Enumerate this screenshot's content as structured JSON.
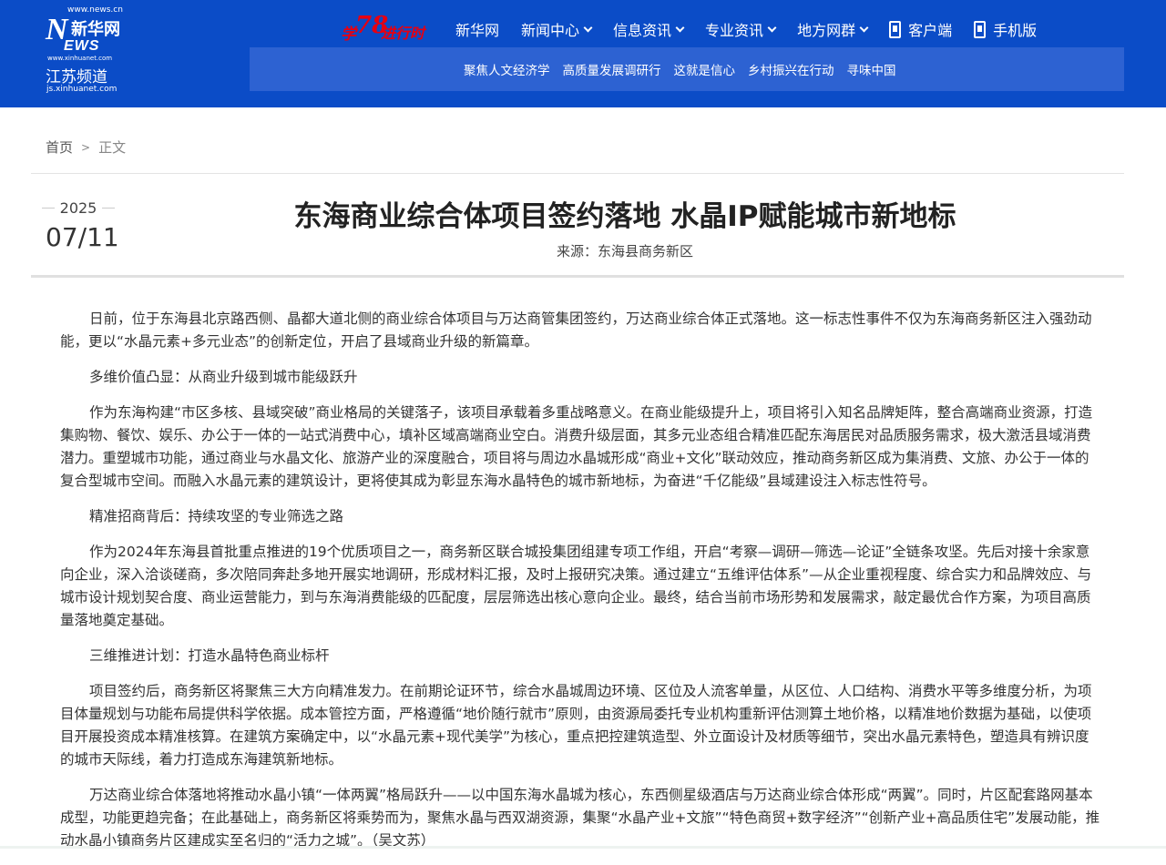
{
  "header": {
    "logo": {
      "url": "www.news.cn",
      "brand_cn": "新华网",
      "brand_en": "EWS",
      "brand_n": "N",
      "sub": "www.xinhuanet.com",
      "channel": "江苏频道",
      "domain": "js.xinhuanet.com"
    },
    "badge": {
      "xue": "学",
      "num": "78",
      "jx": "进行时"
    },
    "nav": [
      {
        "label": "新华网",
        "has_dropdown": false
      },
      {
        "label": "新闻中心",
        "has_dropdown": true
      },
      {
        "label": "信息资讯",
        "has_dropdown": true
      },
      {
        "label": "专业资讯",
        "has_dropdown": true
      },
      {
        "label": "地方网群",
        "has_dropdown": true
      },
      {
        "label": "客户端",
        "icon": "mobile-icon"
      },
      {
        "label": "手机版",
        "icon": "mobile-icon"
      }
    ],
    "sub_nav": [
      "聚焦人文经济学",
      "高质量发展调研行",
      "这就是信心",
      "乡村振兴在行动",
      "寻味中国"
    ]
  },
  "breadcrumb": {
    "home": "首页",
    "separator": ">",
    "current": "正文"
  },
  "article": {
    "year": "2025",
    "month_day": "07/11",
    "title": "东海商业综合体项目签约落地 水晶IP赋能城市新地标",
    "source": "来源：东海县商务新区",
    "paragraphs": [
      "日前，位于东海县北京路西侧、晶都大道北侧的商业综合体项目与万达商管集团签约，万达商业综合体正式落地。这一标志性事件不仅为东海商务新区注入强劲动能，更以“水晶元素+多元业态”的创新定位，开启了县域商业升级的新篇章。",
      "多维价值凸显：从商业升级到城市能级跃升",
      "作为东海构建“市区多核、县域突破”商业格局的关键落子，该项目承载着多重战略意义。在商业能级提升上，项目将引入知名品牌矩阵，整合高端商业资源，打造集购物、餐饮、娱乐、办公于一体的一站式消费中心，填补区域高端商业空白。消费升级层面，其多元业态组合精准匹配东海居民对品质服务需求，极大激活县域消费潜力。重塑城市功能，通过商业与水晶文化、旅游产业的深度融合，项目将与周边水晶城形成“商业+文化”联动效应，推动商务新区成为集消费、文旅、办公于一体的复合型城市空间。而融入水晶元素的建筑设计，更将使其成为彰显东海水晶特色的城市新地标，为奋进“千亿能级”县域建设注入标志性符号。",
      "精准招商背后：持续攻坚的专业筛选之路",
      "作为2024年东海县首批重点推进的19个优质项目之一，商务新区联合城投集团组建专项工作组，开启“考察—调研—筛选—论证”全链条攻坚。先后对接十余家意向企业，深入洽谈磋商，多次陪同奔赴多地开展实地调研，形成材料汇报，及时上报研究决策。通过建立“五维评估体系”—从企业重视程度、综合实力和品牌效应、与城市设计规划契合度、商业运营能力，到与东海消费能级的匹配度，层层筛选出核心意向企业。最终，结合当前市场形势和发展需求，敲定最优合作方案，为项目高质量落地奠定基础。",
      "三维推进计划：打造水晶特色商业标杆",
      "项目签约后，商务新区将聚焦三大方向精准发力。在前期论证环节，综合水晶城周边环境、区位及人流客单量，从区位、人口结构、消费水平等多维度分析，为项目体量规划与功能布局提供科学依据。成本管控方面，严格遵循“地价随行就市”原则，由资源局委托专业机构重新评估测算土地价格，以精准地价数据为基础，以使项目开展投资成本精准核算。在建筑方案确定中，以“水晶元素+现代美学”为核心，重点把控建筑造型、外立面设计及材质等细节，突出水晶元素特色，塑造具有辨识度的城市天际线，着力打造成东海建筑新地标。",
      "万达商业综合体落地将推动水晶小镇“一体两翼”格局跃升——以中国东海水晶城为核心，东西侧星级酒店与万达商业综合体形成“两翼”。同时，片区配套路网基本成型，功能更趋完备；在此基础上，商务新区将乘势而为，聚焦水晶与西双湖资源，集聚“水晶产业+文旅”“特色商贸+数字经济”“创新产业+高品质住宅”发展动能，推动水晶小镇商务片区建成实至名归的“活力之城”。（吴文苏）"
    ]
  },
  "colors": {
    "header_bg": "#0b4cc7",
    "sub_nav_bg": "#2d62d2",
    "badge_red": "#e60012"
  }
}
